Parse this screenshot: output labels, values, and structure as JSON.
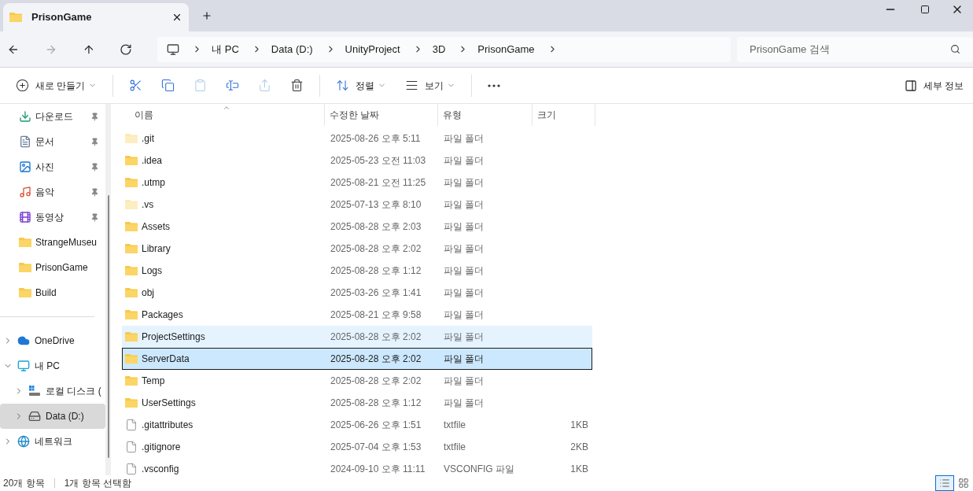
{
  "tab": {
    "title": "PrisonGame",
    "selected": true
  },
  "nav": [
    {
      "kind": "back",
      "disabled": false
    },
    {
      "kind": "forward",
      "disabled": true
    },
    {
      "kind": "up",
      "disabled": false
    },
    {
      "kind": "refresh",
      "disabled": false
    }
  ],
  "breadcrumb": [
    "내 PC",
    "Data (D:)",
    "UnityProject",
    "3D",
    "PrisonGame"
  ],
  "search": {
    "placeholder": "PrisonGame 검색"
  },
  "toolbar": [
    {
      "kind": "new",
      "label": "새로 만들기",
      "disabled": false
    },
    {
      "kind": "cut",
      "disabled": false
    },
    {
      "kind": "copy",
      "disabled": false
    },
    {
      "kind": "paste",
      "disabled": true
    },
    {
      "kind": "rename",
      "disabled": false
    },
    {
      "kind": "share",
      "disabled": true
    },
    {
      "kind": "delete",
      "disabled": false
    },
    {
      "kind": "sort",
      "label": "정렬",
      "disabled": false
    },
    {
      "kind": "view",
      "label": "보기",
      "disabled": false
    },
    {
      "kind": "more",
      "disabled": false
    }
  ],
  "details_button": "세부 정보",
  "quick_access": [
    {
      "kind": "download",
      "label": "다운로드",
      "pinned": true
    },
    {
      "kind": "document",
      "label": "문서",
      "pinned": true
    },
    {
      "kind": "picture",
      "label": "사진",
      "pinned": true
    },
    {
      "kind": "music",
      "label": "음악",
      "pinned": true
    },
    {
      "kind": "video",
      "label": "동영상",
      "pinned": true
    },
    {
      "kind": "folder",
      "label": "StrangeMuseu",
      "pinned": false
    },
    {
      "kind": "folder",
      "label": "PrisonGame",
      "pinned": false
    },
    {
      "kind": "folder",
      "label": "Build",
      "pinned": false
    }
  ],
  "tree": [
    {
      "kind": "cloud",
      "label": "OneDrive",
      "expanded": false,
      "selected": false
    },
    {
      "kind": "pc",
      "label": "내 PC",
      "expanded": true,
      "selected": false,
      "children": [
        {
          "kind": "windisk",
          "label": "로컬 디스크 (",
          "expanded": false,
          "selected": false
        },
        {
          "kind": "disk",
          "label": "Data (D:)",
          "expanded": false,
          "selected": true
        }
      ]
    },
    {
      "kind": "network",
      "label": "네트워크",
      "expanded": false,
      "selected": false
    }
  ],
  "columns": [
    "이름",
    "수정한 날짜",
    "유형",
    "크기"
  ],
  "rows": [
    {
      "kind": "folder",
      "hidden": true,
      "name": ".git",
      "date": "2025-08-26 오후 5:11",
      "type": "파일 폴더",
      "hovered": false,
      "selected": false
    },
    {
      "kind": "folder",
      "hidden": false,
      "name": ".idea",
      "date": "2025-05-23 오전 11:03",
      "type": "파일 폴더",
      "hovered": false,
      "selected": false
    },
    {
      "kind": "folder",
      "hidden": false,
      "name": ".utmp",
      "date": "2025-08-21 오전 11:25",
      "type": "파일 폴더",
      "hovered": false,
      "selected": false
    },
    {
      "kind": "folder",
      "hidden": true,
      "name": ".vs",
      "date": "2025-07-13 오후 8:10",
      "type": "파일 폴더",
      "hovered": false,
      "selected": false
    },
    {
      "kind": "folder",
      "hidden": false,
      "name": "Assets",
      "date": "2025-08-28 오후 2:03",
      "type": "파일 폴더",
      "hovered": false,
      "selected": false
    },
    {
      "kind": "folder",
      "hidden": false,
      "name": "Library",
      "date": "2025-08-28 오후 2:02",
      "type": "파일 폴더",
      "hovered": false,
      "selected": false
    },
    {
      "kind": "folder",
      "hidden": false,
      "name": "Logs",
      "date": "2025-08-28 오후 1:12",
      "type": "파일 폴더",
      "hovered": false,
      "selected": false
    },
    {
      "kind": "folder",
      "hidden": false,
      "name": "obj",
      "date": "2025-03-26 오후 1:41",
      "type": "파일 폴더",
      "hovered": false,
      "selected": false
    },
    {
      "kind": "folder",
      "hidden": false,
      "name": "Packages",
      "date": "2025-08-21 오후 9:58",
      "type": "파일 폴더",
      "hovered": false,
      "selected": false
    },
    {
      "kind": "folder",
      "hidden": false,
      "name": "ProjectSettings",
      "date": "2025-08-28 오후 2:02",
      "type": "파일 폴더",
      "hovered": true,
      "selected": false
    },
    {
      "kind": "folder",
      "hidden": false,
      "name": "ServerData",
      "date": "2025-08-28 오후 2:02",
      "type": "파일 폴더",
      "hovered": false,
      "selected": true
    },
    {
      "kind": "folder",
      "hidden": false,
      "name": "Temp",
      "date": "2025-08-28 오후 2:02",
      "type": "파일 폴더",
      "hovered": false,
      "selected": false
    },
    {
      "kind": "folder",
      "hidden": false,
      "name": "UserSettings",
      "date": "2025-08-28 오후 1:12",
      "type": "파일 폴더",
      "hovered": false,
      "selected": false
    },
    {
      "kind": "file",
      "hidden": false,
      "name": ".gitattributes",
      "date": "2025-06-26 오후 1:51",
      "type": "txtfile",
      "size": "1KB",
      "hovered": false,
      "selected": false
    },
    {
      "kind": "file",
      "hidden": false,
      "name": ".gitignore",
      "date": "2025-07-04 오후 1:53",
      "type": "txtfile",
      "size": "2KB",
      "hovered": false,
      "selected": false
    },
    {
      "kind": "file",
      "hidden": false,
      "name": ".vsconfig",
      "date": "2024-09-10 오후 11:11",
      "type": "VSCONFIG 파일",
      "size": "1KB",
      "hovered": false,
      "selected": false
    }
  ],
  "status_bar": {
    "count": "20개 항목",
    "selection": "1개 항목 선택함"
  },
  "view_modes": [
    {
      "kind": "details",
      "selected": true
    },
    {
      "kind": "tiles",
      "selected": false
    }
  ]
}
